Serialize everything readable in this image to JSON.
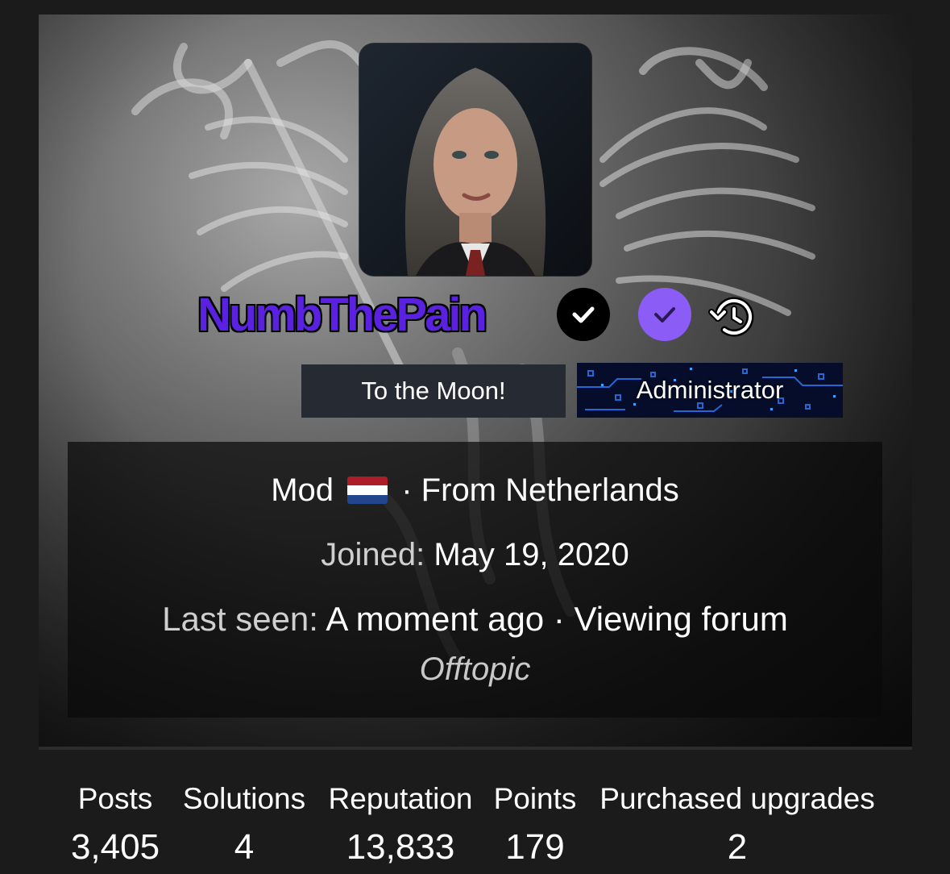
{
  "profile": {
    "username": "NumbThePain",
    "banner_primary": "To the Moon!",
    "banner_role": "Administrator",
    "title": "Mod",
    "location": "· From Netherlands",
    "joined_label": "Joined:",
    "joined_value": "May 19, 2020",
    "last_seen_label": "Last seen:",
    "last_seen_value": "A moment ago · Viewing forum",
    "activity_link": "Offtopic"
  },
  "icons": {
    "verified_black": "check-circle-icon",
    "verified_purple": "check-circle-icon",
    "history": "history-icon",
    "flag": "netherlands-flag-icon"
  },
  "colors": {
    "username": "#5a22e0",
    "verified_purple": "#8b5cf6",
    "flag_red": "#ae1c28",
    "flag_white": "#ffffff",
    "flag_blue": "#21468b"
  },
  "stats": {
    "posts_label": "Posts",
    "posts_value": "3,405",
    "solutions_label": "Solutions",
    "solutions_value": "4",
    "reputation_label": "Reputation",
    "reputation_value": "13,833",
    "points_label": "Points",
    "points_value": "179",
    "upgrades_label": "Purchased upgrades",
    "upgrades_value": "2"
  }
}
